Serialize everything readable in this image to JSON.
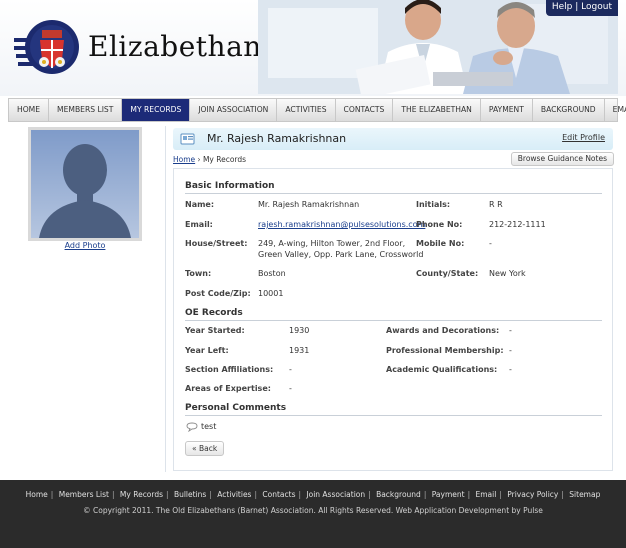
{
  "brand": {
    "name": "Elizabethans"
  },
  "userbar": {
    "help": "Help",
    "separator": "|",
    "logout": "Logout"
  },
  "nav": [
    {
      "label": "HOME",
      "active": false
    },
    {
      "label": "MEMBERS LIST",
      "active": false
    },
    {
      "label": "MY RECORDS",
      "active": true
    },
    {
      "label": "JOIN ASSOCIATION",
      "active": false
    },
    {
      "label": "ACTIVITIES",
      "active": false
    },
    {
      "label": "CONTACTS",
      "active": false
    },
    {
      "label": "THE ELIZABETHAN",
      "active": false
    },
    {
      "label": "PAYMENT",
      "active": false
    },
    {
      "label": "BACKGROUND",
      "active": false
    },
    {
      "label": "EMAIL",
      "active": false
    }
  ],
  "sidebar": {
    "add_photo": "Add Photo"
  },
  "page": {
    "title": "Mr. Rajesh Ramakrishnan",
    "edit_profile": "Edit Profile",
    "breadcrumb_home": "Home",
    "breadcrumb_sep": "›",
    "breadcrumb_current": "My Records",
    "guidance_button": "Browse Guidance Notes"
  },
  "basic": {
    "heading": "Basic Information",
    "name_label": "Name:",
    "name": "Mr. Rajesh Ramakrishnan",
    "initials_label": "Initials:",
    "initials": "R R",
    "email_label": "Email:",
    "email": "rajesh.ramakrishnan@pulsesolutions.com",
    "phone_label": "Phone No:",
    "phone": "212-212-1111",
    "house_label": "House/Street:",
    "house_line1": "249, A-wing, Hilton Tower, 2nd Floor,",
    "house_line2": "Green Valley, Opp. Park Lane, Crossworld",
    "mobile_label": "Mobile No:",
    "mobile": "-",
    "town_label": "Town:",
    "town": "Boston",
    "county_label": "County/State:",
    "county": "New York",
    "postcode_label": "Post Code/Zip:",
    "postcode": "10001"
  },
  "oe": {
    "heading": "OE Records",
    "year_started_label": "Year Started:",
    "year_started": "1930",
    "awards_label": "Awards and Decorations:",
    "awards": "-",
    "year_left_label": "Year Left:",
    "year_left": "1931",
    "professional_label": "Professional Membership:",
    "professional": "-",
    "section_label": "Section Affiliations:",
    "section": "-",
    "academic_label": "Academic Qualifications:",
    "academic": "-",
    "expertise_label": "Areas of Expertise:",
    "expertise": "-"
  },
  "comments": {
    "heading": "Personal Comments",
    "text": "test"
  },
  "back_button": "« Back",
  "footer": {
    "links": [
      "Home",
      "Members List",
      "My Records",
      "Bulletins",
      "Activities",
      "Contacts",
      "Join Association",
      "Background",
      "Payment",
      "Email",
      "Privacy Policy",
      "Sitemap"
    ],
    "copyright": "© Copyright 2011. The Old Elizabethans (Barnet) Association. All Rights Reserved. Web Application Development by Pulse"
  }
}
